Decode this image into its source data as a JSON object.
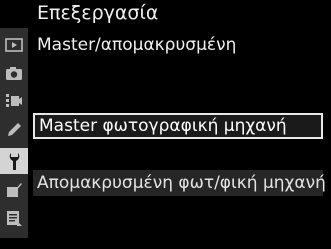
{
  "header": {
    "title": "Επεξεργασία",
    "subtitle": "Master/απομακρυσμένη"
  },
  "menu": {
    "options": [
      {
        "label": "Master φωτογραφική μηχανή",
        "selected": true
      },
      {
        "label": "Απομακρυσμένη φωτ/φική μηχανή",
        "selected": false
      }
    ]
  },
  "sidebar": {
    "icons": [
      {
        "name": "playback-menu-icon",
        "active": false
      },
      {
        "name": "photo-shooting-menu-icon",
        "active": false
      },
      {
        "name": "movie-shooting-menu-icon",
        "active": false
      },
      {
        "name": "custom-settings-pencil-icon",
        "active": false
      },
      {
        "name": "setup-wrench-icon",
        "active": true
      },
      {
        "name": "retouch-menu-icon",
        "active": false
      },
      {
        "name": "my-menu-icon",
        "active": false
      }
    ]
  },
  "colors": {
    "background": "#000000",
    "sidebar": "#2e2e2e",
    "selected_border": "#e8e8e8",
    "active_tab": "#d4d4d4"
  }
}
